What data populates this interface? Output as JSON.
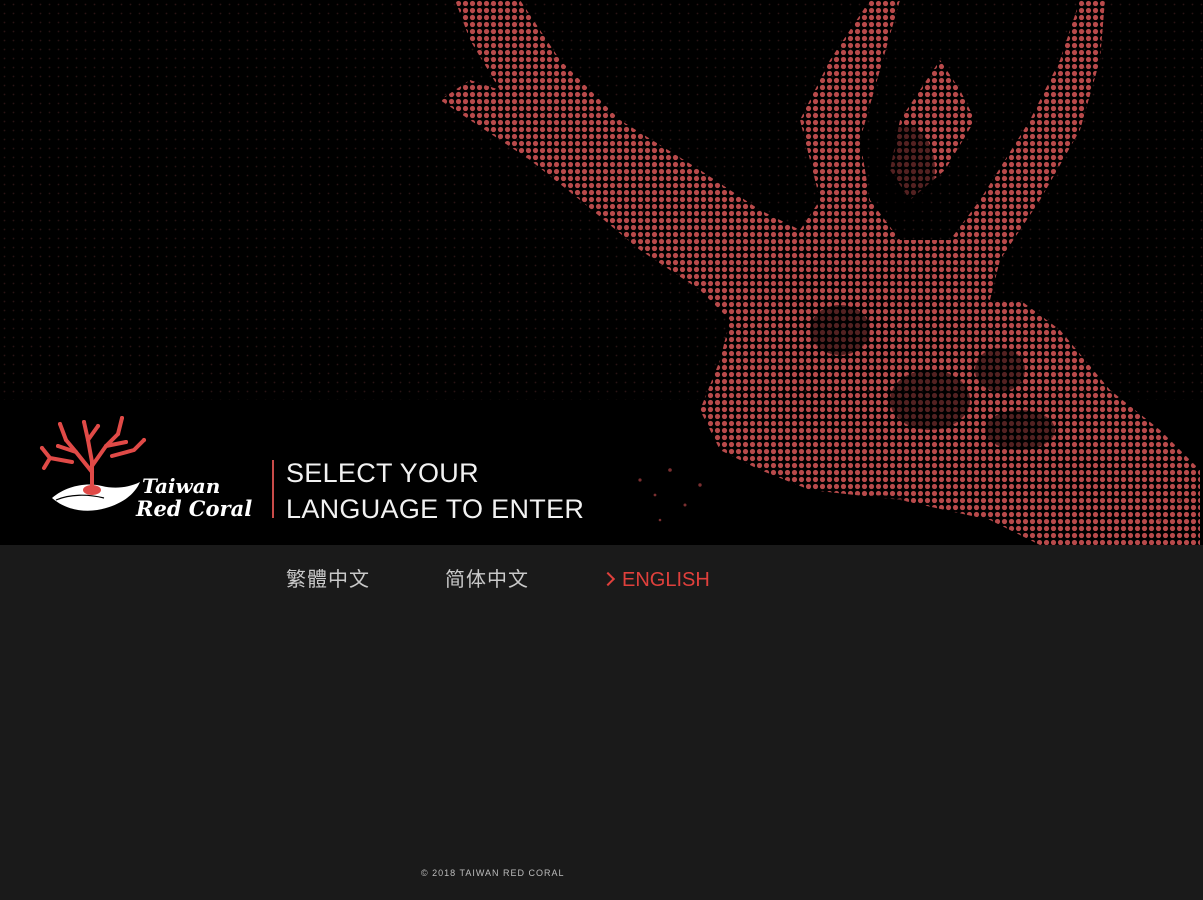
{
  "brand": {
    "logo_line1": "Taiwan",
    "logo_line2": "Red Coral",
    "accent_color": "#c94b49",
    "icon": "coral-logo-icon"
  },
  "intro": {
    "line1": "SELECT YOUR",
    "line2": "LANGUAGE TO ENTER"
  },
  "languages": [
    {
      "label": "繁體中文",
      "selected": false
    },
    {
      "label": "简体中文",
      "selected": false
    },
    {
      "label": "ENGLISH",
      "selected": true,
      "icon": "chevron-right-icon"
    }
  ],
  "footer": {
    "copyright": "© 2018 TAIWAN RED CORAL"
  }
}
